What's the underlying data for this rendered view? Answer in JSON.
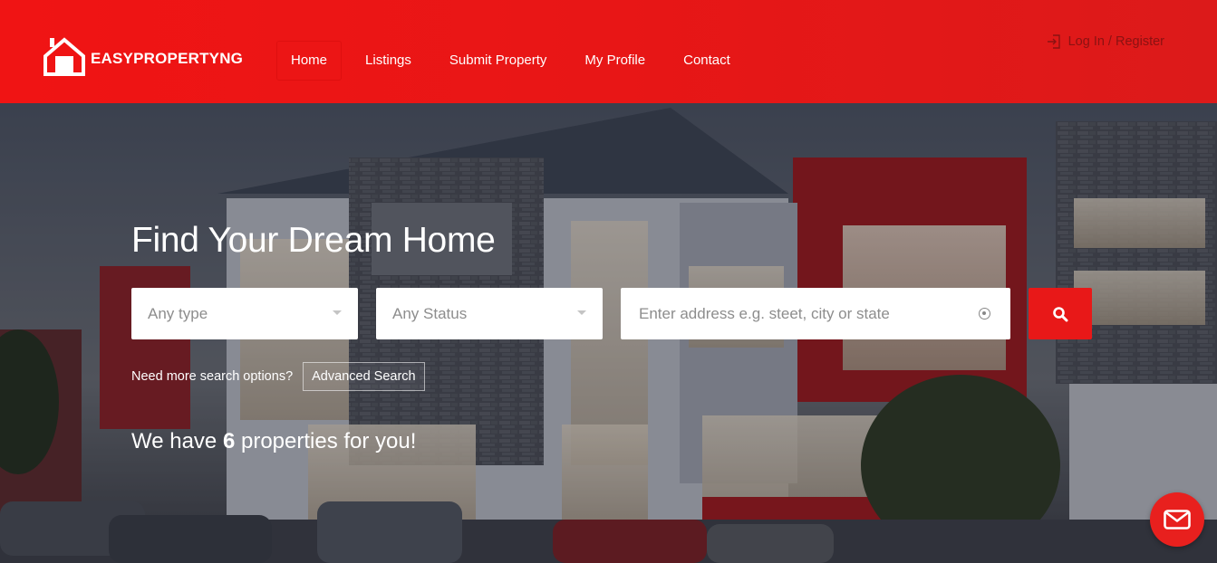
{
  "brand": {
    "name": "EASYPROPERTYNG",
    "accent": "#e81818"
  },
  "nav": {
    "items": [
      {
        "label": "Home",
        "active": true
      },
      {
        "label": "Listings"
      },
      {
        "label": "Submit Property"
      },
      {
        "label": "My Profile"
      },
      {
        "label": "Contact"
      }
    ],
    "login_label": "Log In / Register"
  },
  "hero": {
    "title": "Find Your Dream Home",
    "search": {
      "type_value": "Any type",
      "status_value": "Any Status",
      "address_placeholder": "Enter address e.g. steet, city or state"
    },
    "more_options_text": "Need more search options?",
    "advanced_search_label": "Advanced Search",
    "count_prefix": "We have",
    "count_number": "6",
    "count_suffix": "properties for you!"
  },
  "icons": {
    "logo": "house-icon",
    "login": "sign-in-icon",
    "search": "search-icon",
    "location": "location-target-icon",
    "mail": "envelope-icon"
  }
}
